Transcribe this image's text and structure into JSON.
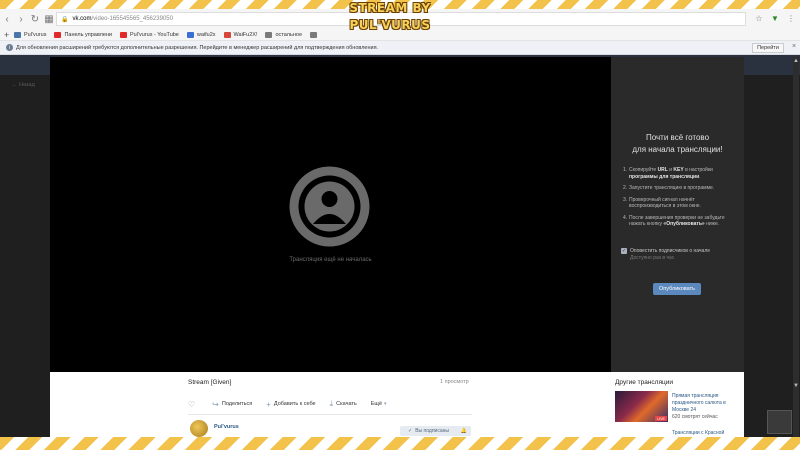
{
  "overlay": {
    "title": "STREAM BY PUL'VURUS"
  },
  "browser": {
    "url_host": "vk.com",
    "url_path": "/video-165545565_456239050"
  },
  "bookmarks": [
    {
      "label": "Pul'vurus",
      "color": "#4a76a8"
    },
    {
      "label": "Панель управлени",
      "color": "#e02a2a"
    },
    {
      "label": "Pul'vurus - YouTube",
      "color": "#e02a2a"
    },
    {
      "label": "waifu2x",
      "color": "#3b6fd6"
    },
    {
      "label": "WaiFu2X!",
      "color": "#d6463b"
    },
    {
      "label": "остальное",
      "color": "#7a7a7a"
    },
    {
      "label": "",
      "color": "#7a7a7a"
    }
  ],
  "infobar": {
    "text": "Для обновления расширений требуются дополнительные разрешения. Перейдите в менеджер расширений для подтверждения обновления.",
    "button": "Перейти"
  },
  "page": {
    "back_text": "← Назад"
  },
  "player": {
    "status": "Трансляция ещё не началась"
  },
  "side_panel": {
    "title_line1": "Почти всё готово",
    "title_line2": "для начала трансляции!",
    "steps": [
      {
        "num": "1.",
        "pre": "Скопируйте ",
        "bold1": "URL",
        "mid": " и ",
        "bold2": "KEY",
        "post": " в настройки ",
        "bold3": "программы для трансляции",
        "end": "."
      },
      {
        "num": "2.",
        "text": "Запустите трансляцию в программе."
      },
      {
        "num": "3.",
        "text": "Проверочный сигнал начнёт воспроизводиться в этом окне."
      },
      {
        "num": "4.",
        "pre": "После завершения проверки не забудьте нажать кнопку ",
        "bold1": "«Опубликовать»",
        "post": " ниже."
      }
    ],
    "notify_label": "Оповестить подписчиков о начале",
    "notify_sub": "Доступно раз в час",
    "publish_button": "Опубликовать"
  },
  "video": {
    "title": "Stream [Given]",
    "views": "1 просмотр",
    "actions": {
      "share": "Поделиться",
      "add": "Добавить к себе",
      "download": "Скачать",
      "more": "Ещё"
    },
    "author": "Pul'vurus",
    "subscribed": "Вы подписаны"
  },
  "others": {
    "title": "Другие трансляции",
    "item_title": "Прямая трансляция праздничного салюта в Москве 24",
    "item_viewers": "620 смотрят сейчас",
    "item_badge": "LIVE",
    "next_link": "Трансляции с Красной"
  }
}
